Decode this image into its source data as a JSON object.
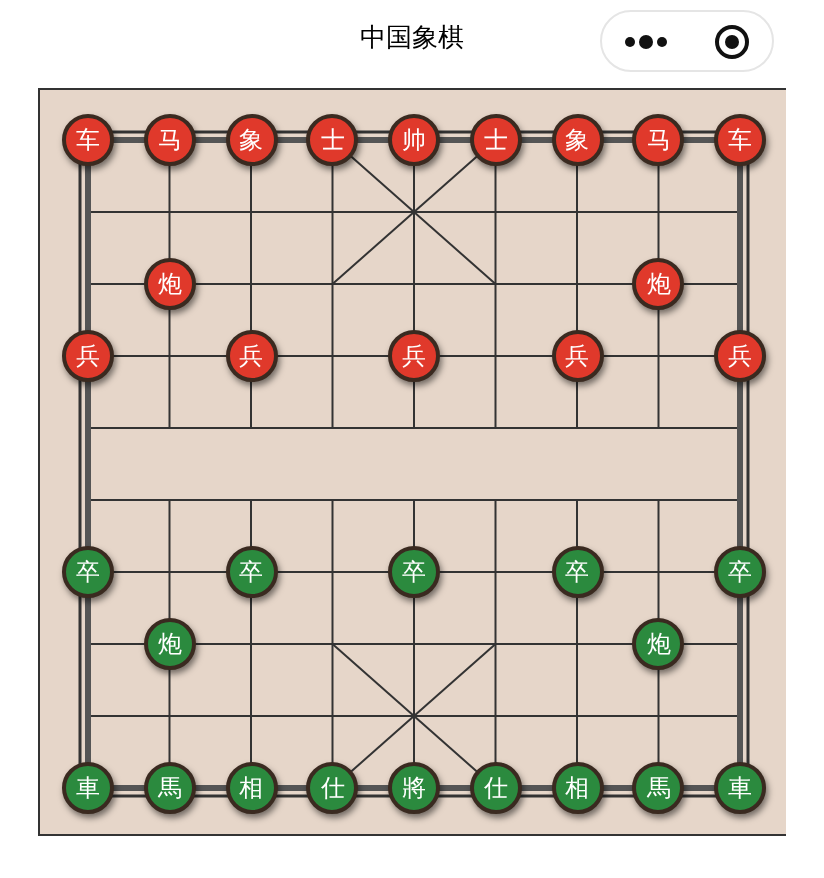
{
  "title": "中国象棋",
  "board": {
    "rows": [
      [
        {
          "label": "车",
          "color": "#e0392b"
        },
        {
          "label": "马",
          "color": "#e0392b"
        },
        {
          "label": "象",
          "color": "#e0392b"
        },
        {
          "label": "士",
          "color": "#e0392b"
        },
        {
          "label": "帅",
          "color": "#e0392b"
        },
        {
          "label": "士",
          "color": "#e0392b"
        },
        {
          "label": "象",
          "color": "#e0392b"
        },
        {
          "label": "马",
          "color": "#e0392b"
        },
        {
          "label": "车",
          "color": "#e0392b"
        }
      ],
      [
        null,
        null,
        null,
        null,
        null,
        null,
        null,
        null,
        null
      ],
      [
        null,
        {
          "label": "炮",
          "color": "#e0392b"
        },
        null,
        null,
        null,
        null,
        null,
        {
          "label": "炮",
          "color": "#e0392b"
        },
        null
      ],
      [
        {
          "label": "兵",
          "color": "#e0392b"
        },
        null,
        {
          "label": "兵",
          "color": "#e0392b"
        },
        null,
        {
          "label": "兵",
          "color": "#e0392b"
        },
        null,
        {
          "label": "兵",
          "color": "#e0392b"
        },
        null,
        {
          "label": "兵",
          "color": "#e0392b"
        }
      ],
      [
        null,
        null,
        null,
        null,
        null,
        null,
        null,
        null,
        null
      ],
      [
        null,
        null,
        null,
        null,
        null,
        null,
        null,
        null,
        null
      ],
      [
        {
          "label": "卒",
          "color": "#2b8a3e"
        },
        null,
        {
          "label": "卒",
          "color": "#2b8a3e"
        },
        null,
        {
          "label": "卒",
          "color": "#2b8a3e"
        },
        null,
        {
          "label": "卒",
          "color": "#2b8a3e"
        },
        null,
        {
          "label": "卒",
          "color": "#2b8a3e"
        }
      ],
      [
        null,
        {
          "label": "炮",
          "color": "#2b8a3e"
        },
        null,
        null,
        null,
        null,
        null,
        {
          "label": "炮",
          "color": "#2b8a3e"
        },
        null
      ],
      [
        null,
        null,
        null,
        null,
        null,
        null,
        null,
        null,
        null
      ],
      [
        {
          "label": "車",
          "color": "#2b8a3e"
        },
        {
          "label": "馬",
          "color": "#2b8a3e"
        },
        {
          "label": "相",
          "color": "#2b8a3e"
        },
        {
          "label": "仕",
          "color": "#2b8a3e"
        },
        {
          "label": "將",
          "color": "#2b8a3e"
        },
        {
          "label": "仕",
          "color": "#2b8a3e"
        },
        {
          "label": "相",
          "color": "#2b8a3e"
        },
        {
          "label": "馬",
          "color": "#2b8a3e"
        },
        {
          "label": "車",
          "color": "#2b8a3e"
        }
      ]
    ]
  }
}
